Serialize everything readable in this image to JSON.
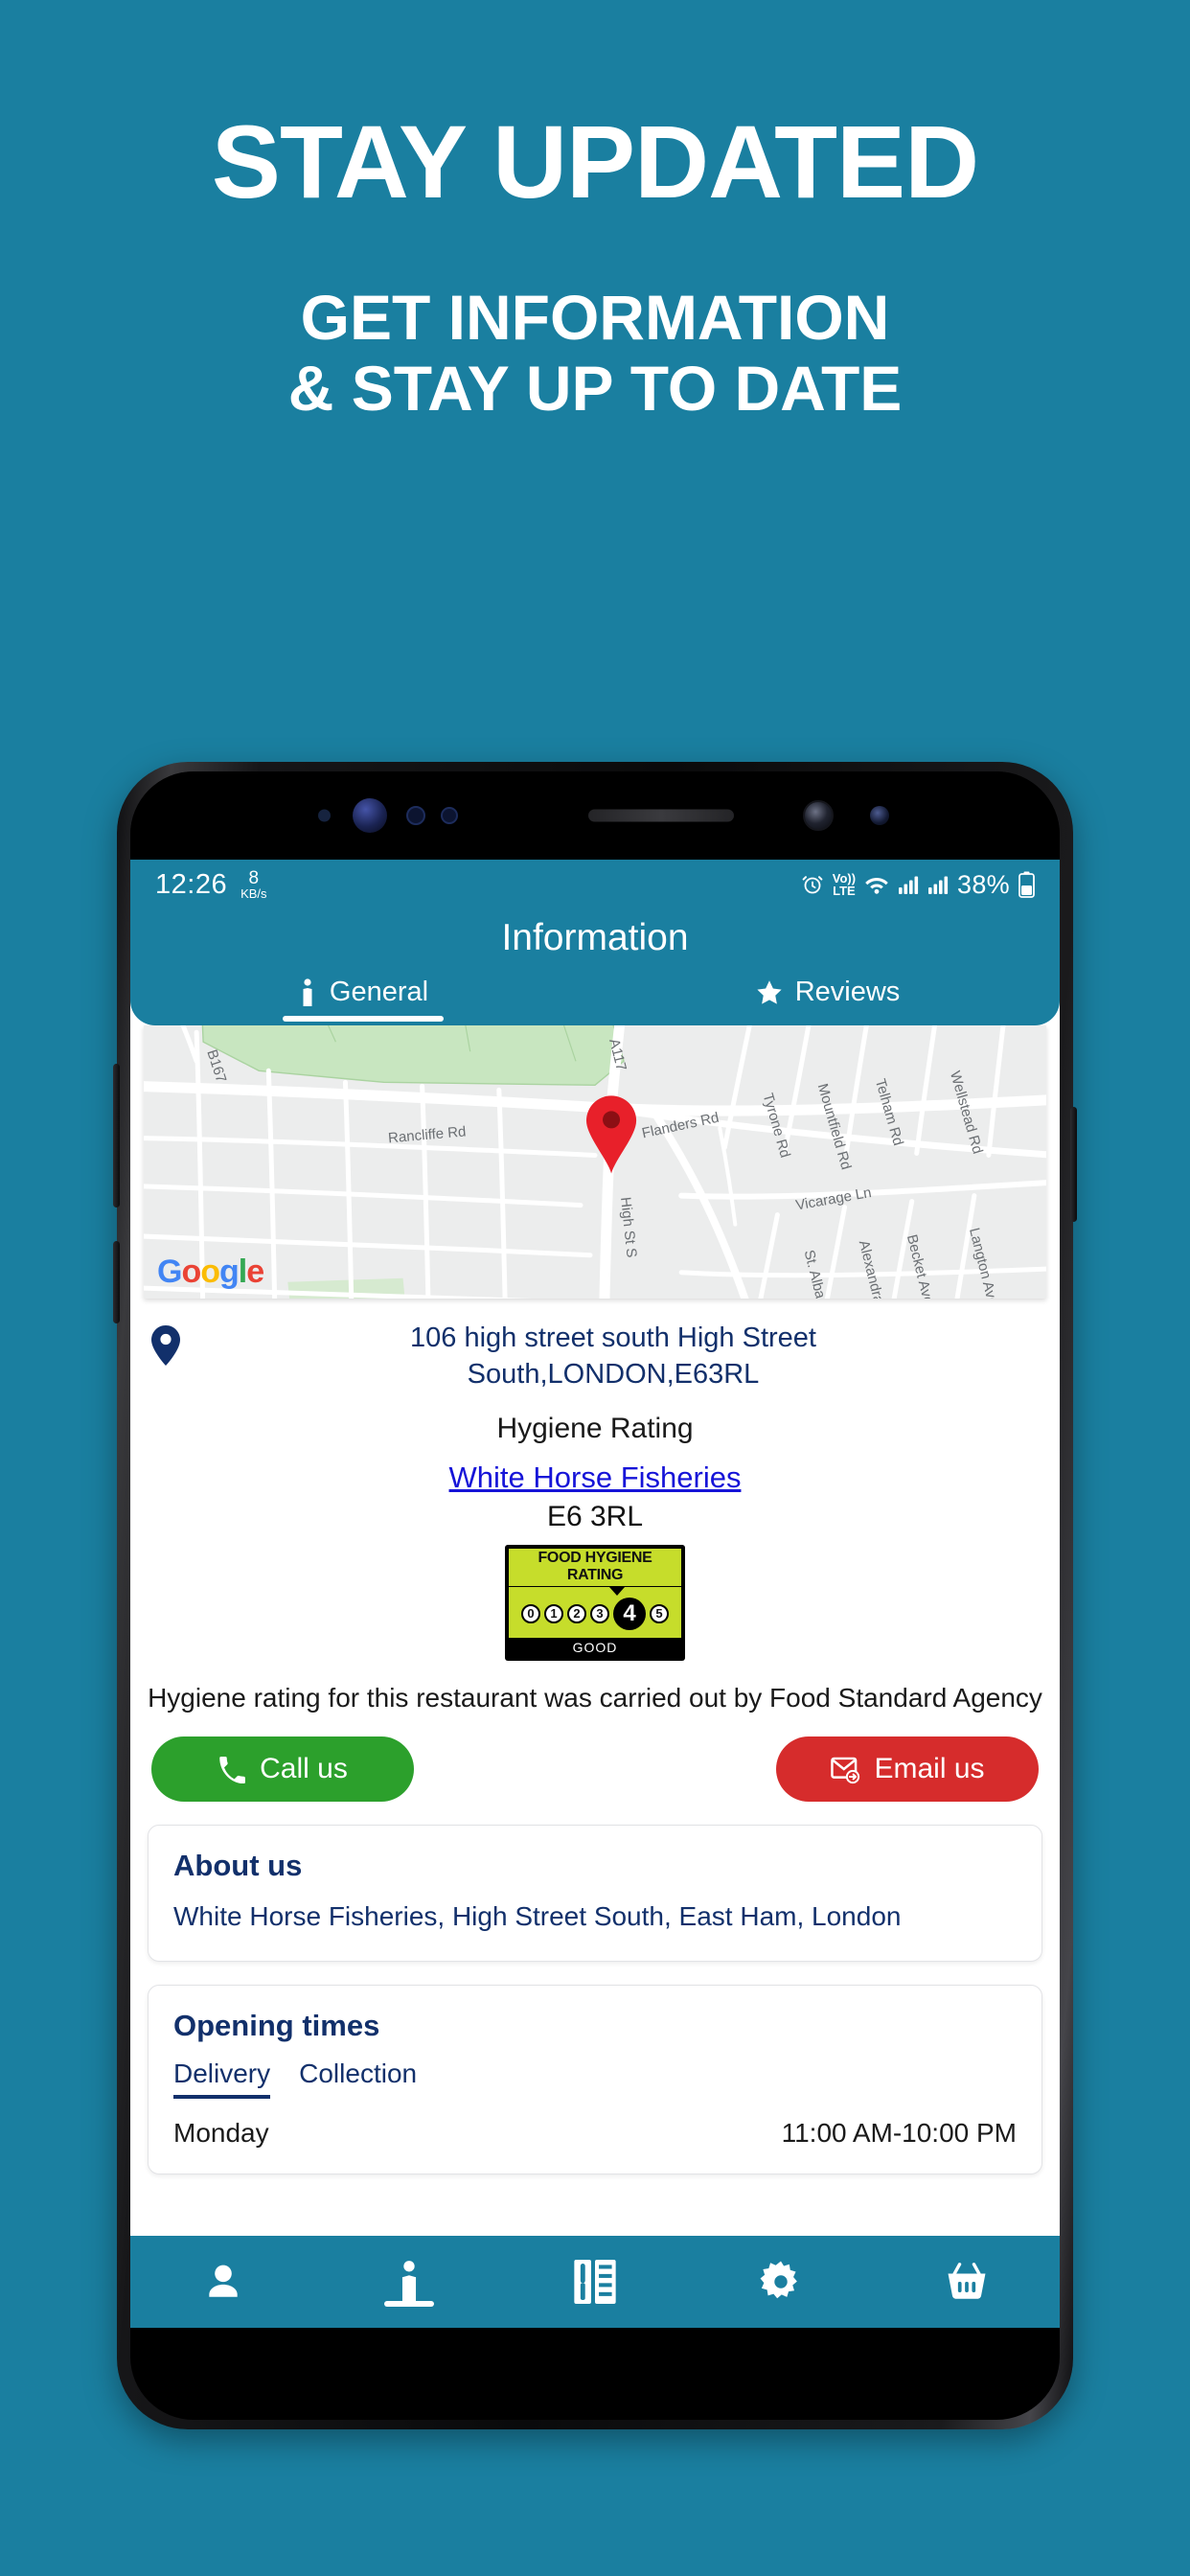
{
  "promo": {
    "title": "STAY UPDATED",
    "subtitle_line1": "GET INFORMATION",
    "subtitle_line2": "& STAY UP TO DATE",
    "background_color": "#1a7fa0",
    "text_color": "#ffffff"
  },
  "status_bar": {
    "time": "12:26",
    "network_speed_value": "8",
    "network_speed_unit": "KB/s",
    "alarm_icon": "alarm-icon",
    "volte_line1": "Vo))",
    "volte_line2": "LTE",
    "wifi_icon": "wifi-icon",
    "signal_icon_1": "signal-bars-icon",
    "signal_icon_2": "signal-bars-icon",
    "battery_percent": "38%",
    "battery_icon": "battery-icon"
  },
  "appbar": {
    "title": "Information",
    "accent_color": "#1a7fa0",
    "tabs": [
      {
        "label": "General",
        "icon": "info-icon",
        "active": true
      },
      {
        "label": "Reviews",
        "icon": "star-icon",
        "active": false
      }
    ]
  },
  "map": {
    "provider_logo": "Google",
    "provider_letters": [
      "G",
      "o",
      "o",
      "g",
      "l",
      "e"
    ],
    "marker_icon": "map-pin-icon",
    "street_labels": [
      "B167",
      "A117",
      "Rancliffe Rd",
      "Flanders Rd",
      "Tyrone Rd",
      "Mountfield Rd",
      "Telham Rd",
      "Wellstead Rd",
      "Vicarage Ln",
      "Langton Ave",
      "Becket Ave",
      "Alexandra Rd",
      "St. Albans Ave",
      "High St S"
    ]
  },
  "address": {
    "pin_icon": "location-pin-icon",
    "line1": "106 high street south  High Street",
    "line2": "South,LONDON,E63RL",
    "text_color": "#12306b"
  },
  "hygiene": {
    "heading": "Hygiene Rating",
    "business_link": "White Horse Fisheries",
    "postcode": "E6 3RL",
    "badge": {
      "header": "FOOD HYGIENE RATING",
      "scores": [
        "0",
        "1",
        "2",
        "3",
        "4",
        "5"
      ],
      "selected_score": "4",
      "footer": "GOOD",
      "badge_color": "#c6dd2b"
    },
    "note": "Hygiene rating for this restaurant was carried out by Food Standard Agency"
  },
  "actions": {
    "call": {
      "label": "Call us",
      "icon": "phone-icon",
      "color": "#2ca02c"
    },
    "email": {
      "label": "Email us",
      "icon": "email-icon",
      "color": "#d62c2c"
    }
  },
  "about": {
    "title": "About us",
    "body": "White Horse Fisheries, High Street South, East Ham, London"
  },
  "opening": {
    "title": "Opening times",
    "tabs": [
      {
        "label": "Delivery",
        "active": true
      },
      {
        "label": "Collection",
        "active": false
      }
    ],
    "rows": [
      {
        "day": "Monday",
        "hours": "11:00 AM-10:00 PM"
      }
    ]
  },
  "bottom_nav": [
    {
      "name": "account",
      "icon": "person-icon",
      "active": false
    },
    {
      "name": "information",
      "icon": "info-icon",
      "active": true
    },
    {
      "name": "menu",
      "icon": "menu-card-icon",
      "active": false
    },
    {
      "name": "settings",
      "icon": "gear-icon",
      "active": false
    },
    {
      "name": "basket",
      "icon": "basket-icon",
      "active": false
    }
  ]
}
